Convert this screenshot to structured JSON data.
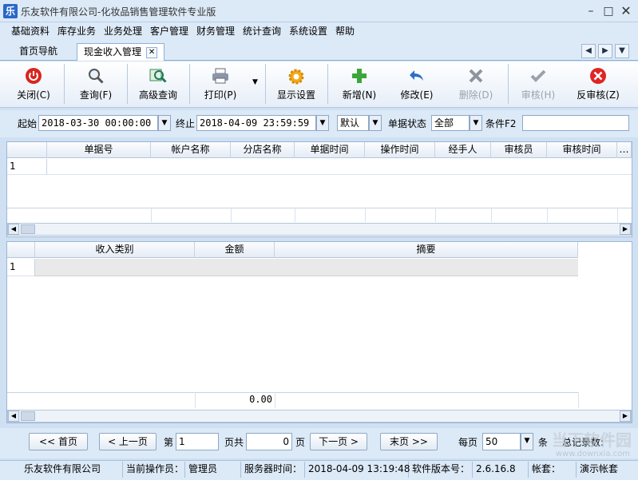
{
  "window": {
    "title": "乐友软件有限公司-化妆品销售管理软件专业版",
    "app_icon_text": "乐"
  },
  "menu": [
    "基础资料",
    "库存业务",
    "业务处理",
    "客户管理",
    "财务管理",
    "统计查询",
    "系统设置",
    "帮助"
  ],
  "tabs": [
    {
      "label": "首页导航"
    },
    {
      "label": "现金收入管理"
    }
  ],
  "toolbar": {
    "buttons": [
      {
        "label": "关闭(C)",
        "icon": "power-icon"
      },
      {
        "label": "查询(F)",
        "icon": "magnifier-icon"
      },
      {
        "label": "高级查询",
        "icon": "advanced-search-icon"
      },
      {
        "label": "打印(P)",
        "icon": "printer-icon"
      },
      {
        "label": "显示设置",
        "icon": "gear-icon"
      },
      {
        "label": "新增(N)",
        "icon": "plus-icon"
      },
      {
        "label": "修改(E)",
        "icon": "undo-arrow-icon"
      },
      {
        "label": "删除(D)",
        "icon": "delete-x-icon"
      },
      {
        "label": "审核(H)",
        "icon": "check-icon"
      },
      {
        "label": "反审核(Z)",
        "icon": "cancel-icon"
      }
    ]
  },
  "filter": {
    "start_label": "起始",
    "start_value": "2018-03-30 00:00:00",
    "end_label": "终止",
    "end_value": "2018-04-09 23:59:59",
    "order_value": "默认",
    "status_label": "单据状态",
    "status_value": "全部",
    "condition_label": "条件F2",
    "condition_value": ""
  },
  "upper_grid": {
    "columns": [
      "单据号",
      "帐户名称",
      "分店名称",
      "单据时间",
      "操作时间",
      "经手人",
      "审核员",
      "审核时间"
    ],
    "rows": [
      {
        "num": "1"
      }
    ]
  },
  "lower_grid": {
    "columns": [
      "收入类别",
      "金额",
      "摘要"
    ],
    "rows": [
      {
        "num": "1"
      }
    ],
    "footer_amount": "0.00"
  },
  "pager": {
    "first": "<< 首页",
    "prev": "< 上一页",
    "page_label": "第",
    "page_value": "1",
    "page_total_label": "页共",
    "page_total_value": "0",
    "page_unit": "页",
    "next": "下一页 >",
    "last": "末页 >>",
    "per_page_label": "每页",
    "per_page_value": "50",
    "per_page_unit": "条",
    "total_label": "总记录数:"
  },
  "status": {
    "company": "乐友软件有限公司",
    "operator_label": "当前操作员：",
    "operator": "管理员",
    "server_time_label": "服务器时间：",
    "server_time": "2018-04-09 13:19:48",
    "version_label": "软件版本号：",
    "version": "2.6.16.8",
    "account_label": "帐套：",
    "account": "演示帐套"
  },
  "watermark": {
    "text": "当下软件园",
    "url": "www.downxia.com"
  }
}
